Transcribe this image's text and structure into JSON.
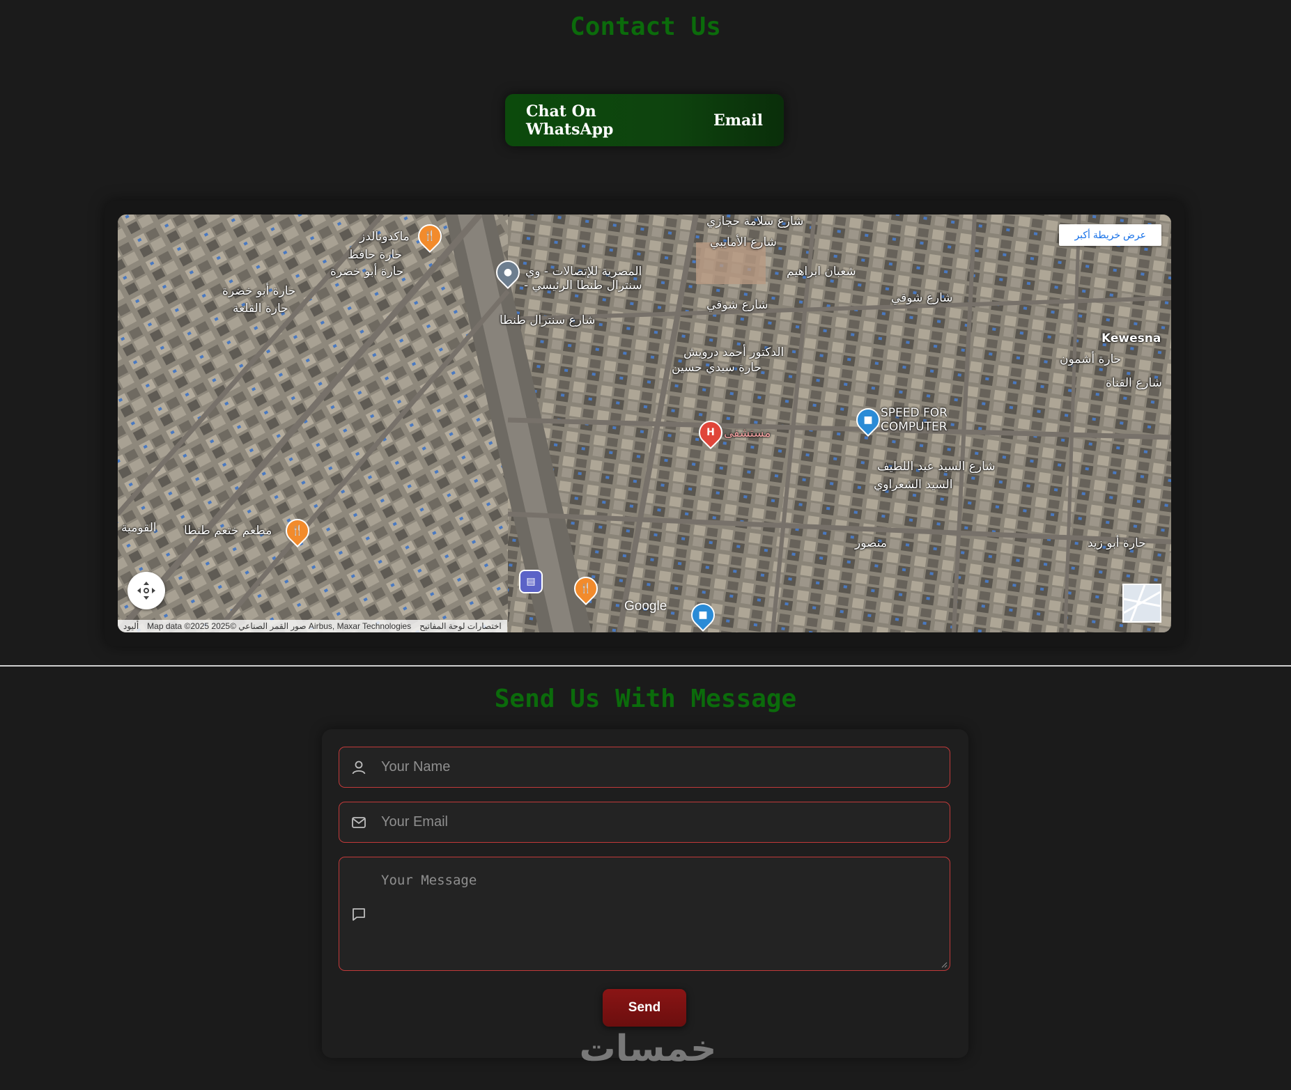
{
  "contact": {
    "title": "Contact Us",
    "whatsapp_label": "Chat On WhatsApp",
    "email_label": "Email"
  },
  "map": {
    "larger_map_label": "عرض خريطة أكبر",
    "google_logo": "Google",
    "attribution": {
      "updates": "أليود",
      "map_data": "Map data ©2025 2025© صور القمر الصناعي Airbus, Maxar Technologies",
      "shortcuts": "اختصارات لوحة المفاتيح"
    },
    "labels": {
      "mcdonalds": "ماكدونالدز",
      "hafez": "حارة حافظ",
      "abu_khadra": "حارة أبو خضرة",
      "abu_khadra_2": "حارة أبو خضرة",
      "qalaa": "حارة القلعة",
      "telecom_1": "المصرية للإتصالات - وي",
      "telecom_2": "- سنترال طنطا الرئيسي",
      "central_st": "شارع سنترال طنطا",
      "salama_hegazy": "شارع سلامة حجازي",
      "amayeb": "شارع الأمايبي",
      "shaaban_ibrahim": "شعبان ابراهيم",
      "shawqi": "شارع شوقي",
      "shawqi_2": "شارع شوقي",
      "kewesna": "Kewesna",
      "ashmoun": "حارة أشمون",
      "darwish": "الدكتور أحمد درويش",
      "sidi_hassanein": "حارة سيدي حسين",
      "speed_1": "SPEED FOR",
      "speed_2": "COMPUTER",
      "hospital": "مستشفى",
      "abdellatif": "شارع السيد عبد اللطيف",
      "shaarawy": "السيد الشعراوي",
      "khatam": "مطعم ختعم طنطا",
      "qawmia": "القومية",
      "qanaa": "شارع القناة",
      "abu_zeid": "حارة أبو زيد",
      "mansour": "منصور"
    }
  },
  "message": {
    "title": "Send Us With Message",
    "name_placeholder": "Your Name",
    "email_placeholder": "Your Email",
    "message_placeholder": "Your Message",
    "send_label": "Send"
  },
  "watermark": "خمسات"
}
